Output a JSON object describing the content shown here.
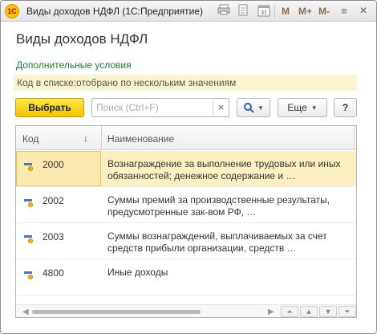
{
  "window": {
    "title": "Виды доходов НДФЛ  (1С:Предприятие)",
    "logo_text": "1С",
    "toolbar": {
      "print_icon": "printer-icon",
      "doc_icon": "document-icon",
      "calendar_icon": "calendar-icon",
      "calendar_label": "31",
      "m_label": "M",
      "m_plus_label": "M+",
      "m_minus_label": "M-",
      "menu_icon": "menu-icon",
      "close_icon": "close-icon",
      "close_label": "×",
      "menu_label": "≡"
    }
  },
  "page": {
    "title": "Виды доходов НДФЛ",
    "extra_conditions_link": "Дополнительные условия",
    "filter_text": "Код в списке:отобрано по нескольким значениям"
  },
  "command_bar": {
    "select_button": "Выбрать",
    "search_placeholder": "Поиск (Ctrl+F)",
    "search_value": "",
    "clear_label": "×",
    "find_label": "🔍",
    "more_button": "Еще",
    "help_button": "?"
  },
  "grid": {
    "columns": [
      "Код",
      "Наименование"
    ],
    "sort_indicator": "↓",
    "rows": [
      {
        "code": "2000",
        "name": "Вознаграждение за выполнение трудовых или иных обязанностей; денежное содержание и …",
        "selected": true
      },
      {
        "code": "2002",
        "name": "Суммы премий за производственные результаты, предусмотренные зак-вом РФ, …",
        "selected": false
      },
      {
        "code": "2003",
        "name": "Суммы вознаграждений, выплачиваемых за счет средств прибыли организации, средств …",
        "selected": false
      },
      {
        "code": "4800",
        "name": "Иные доходы",
        "selected": false
      }
    ],
    "nav": {
      "first": "⏶",
      "up": "▲",
      "down": "▼",
      "last": "⏷"
    }
  },
  "colors": {
    "primary_button": "#f2c500",
    "filter_bg": "#fbf5cd",
    "link": "#1a7f3a",
    "selected_row": "#fbf0c2"
  }
}
